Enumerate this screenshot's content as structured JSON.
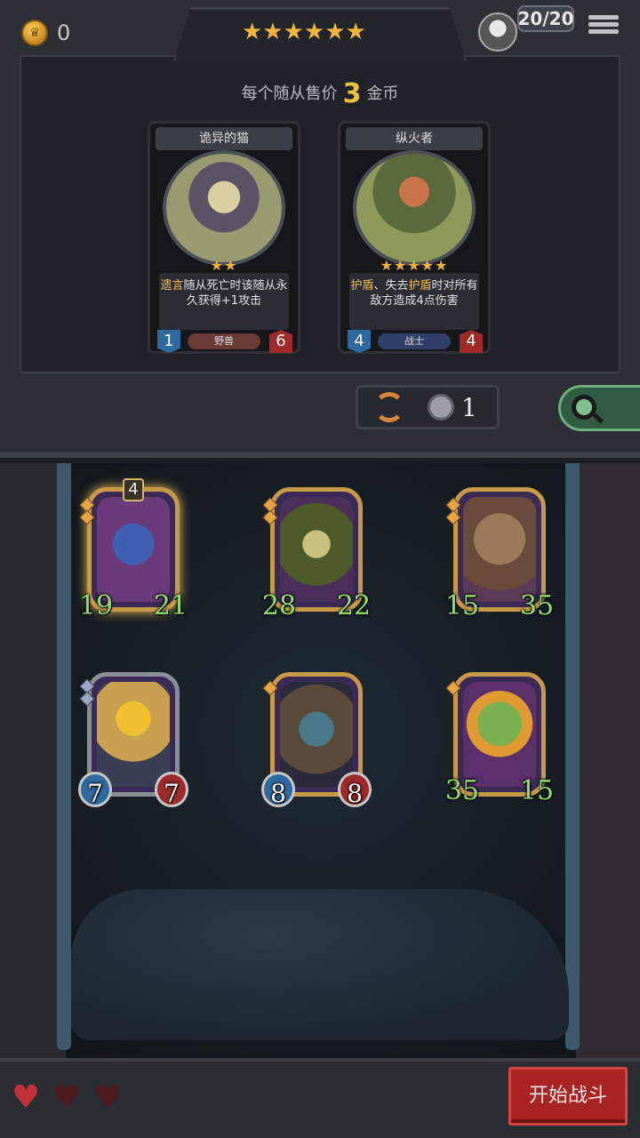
{
  "top": {
    "gold": "0",
    "star_rating": "★★★★★★",
    "turn_counter": "20/20"
  },
  "shop": {
    "price_prefix": "每个随从售价",
    "price_value": "3",
    "price_suffix": "金币",
    "cards": [
      {
        "name": "诡异的猫",
        "stars": "★★",
        "desc_keyword": "遗言",
        "desc_rest": "随从死亡时该随从永久获得+1攻击",
        "attack": "1",
        "health": "6",
        "tribe": "野兽",
        "tribe_color": "#6a3a34"
      },
      {
        "name": "纵火者",
        "stars": "★★★★★",
        "desc_keyword": "护盾",
        "desc_mid": "、失去",
        "desc_keyword2": "护盾",
        "desc_rest": "时对所有敌方造成4点伤害",
        "attack": "4",
        "health": "4",
        "tribe": "战士",
        "tribe_color": "#2f3f6a"
      }
    ],
    "refresh_cost": "1"
  },
  "board": {
    "minions": [
      {
        "attack": "19",
        "health": "21",
        "badge": "4",
        "golden": true,
        "pips": 2
      },
      {
        "attack": "28",
        "health": "22",
        "golden": false,
        "pips": 2
      },
      {
        "attack": "15",
        "health": "35",
        "golden": false,
        "pips": 2
      },
      {
        "attack": "7",
        "health": "7",
        "golden": false,
        "pips": 2
      },
      {
        "attack": "8",
        "health": "8",
        "golden": false,
        "pips": 1
      },
      {
        "attack": "35",
        "health": "15",
        "golden": false,
        "pips": 1
      }
    ]
  },
  "bottom": {
    "lives": 1,
    "start_button": "开始战斗"
  }
}
